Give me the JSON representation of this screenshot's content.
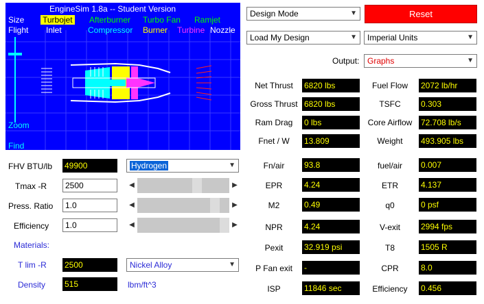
{
  "engine_view": {
    "title": "EngineSim 1.8a  -- Student Version",
    "size_label": "Size",
    "flight_label": "Flight",
    "zoom_label": "Zoom",
    "find_label": "Find",
    "engine_types": [
      "Turbojet",
      "Afterburner",
      "Turbo Fan",
      "Ramjet"
    ],
    "components": [
      "Inlet",
      "Compressor",
      "Burner",
      "Turbine",
      "Nozzle"
    ],
    "selected_type": "Turbojet"
  },
  "controls": {
    "mode_select": "Design Mode",
    "reset_label": "Reset",
    "design_select": "Load My Design",
    "units_select": "Imperial Units",
    "output_label": "Output:",
    "output_select": "Graphs"
  },
  "results": [
    {
      "label": "Net Thrust",
      "value": "6820 lbs"
    },
    {
      "label": "Fuel Flow",
      "value": "2072 lb/hr"
    },
    {
      "label": "Gross Thrust",
      "value": "6820 lbs"
    },
    {
      "label": "TSFC",
      "value": "0.303"
    },
    {
      "label": "Ram Drag",
      "value": "0 lbs"
    },
    {
      "label": "Core Airflow",
      "value": "72.708 lb/s"
    },
    {
      "label": "Fnet / W",
      "value": "13.809"
    },
    {
      "label": "Weight",
      "value": "493.905 lbs"
    },
    {
      "label": "Fn/air",
      "value": "93.8"
    },
    {
      "label": "fuel/air",
      "value": "0.007"
    },
    {
      "label": "EPR",
      "value": "4.24"
    },
    {
      "label": "ETR",
      "value": "4.137"
    },
    {
      "label": "M2",
      "value": "0.49"
    },
    {
      "label": "q0",
      "value": "0 psf"
    },
    {
      "label": "NPR",
      "value": "4.24"
    },
    {
      "label": "V-exit",
      "value": "2994 fps"
    },
    {
      "label": "Pexit",
      "value": "32.919 psi"
    },
    {
      "label": "T8",
      "value": "1505 R"
    },
    {
      "label": "P Fan exit",
      "value": "-"
    },
    {
      "label": "CPR",
      "value": "8.0"
    },
    {
      "label": "ISP",
      "value": "11846 sec"
    },
    {
      "label": "Efficiency",
      "value": "0.456"
    }
  ],
  "inputs": {
    "fhv_label": "FHV BTU/lb",
    "fhv_value": "49900",
    "fuel_select": "Hydrogen",
    "tmax_label": "Tmax -R",
    "tmax_value": "2500",
    "press_label": "Press. Ratio",
    "press_value": "1.0",
    "eff_label": "Efficiency",
    "eff_value": "1.0",
    "materials_label": "Materials:",
    "tlim_label": "T lim -R",
    "tlim_value": "2500",
    "material_select": "Nickel Alloy",
    "density_label": "Density",
    "density_value": "515",
    "density_unit": "lbm/ft^3"
  }
}
